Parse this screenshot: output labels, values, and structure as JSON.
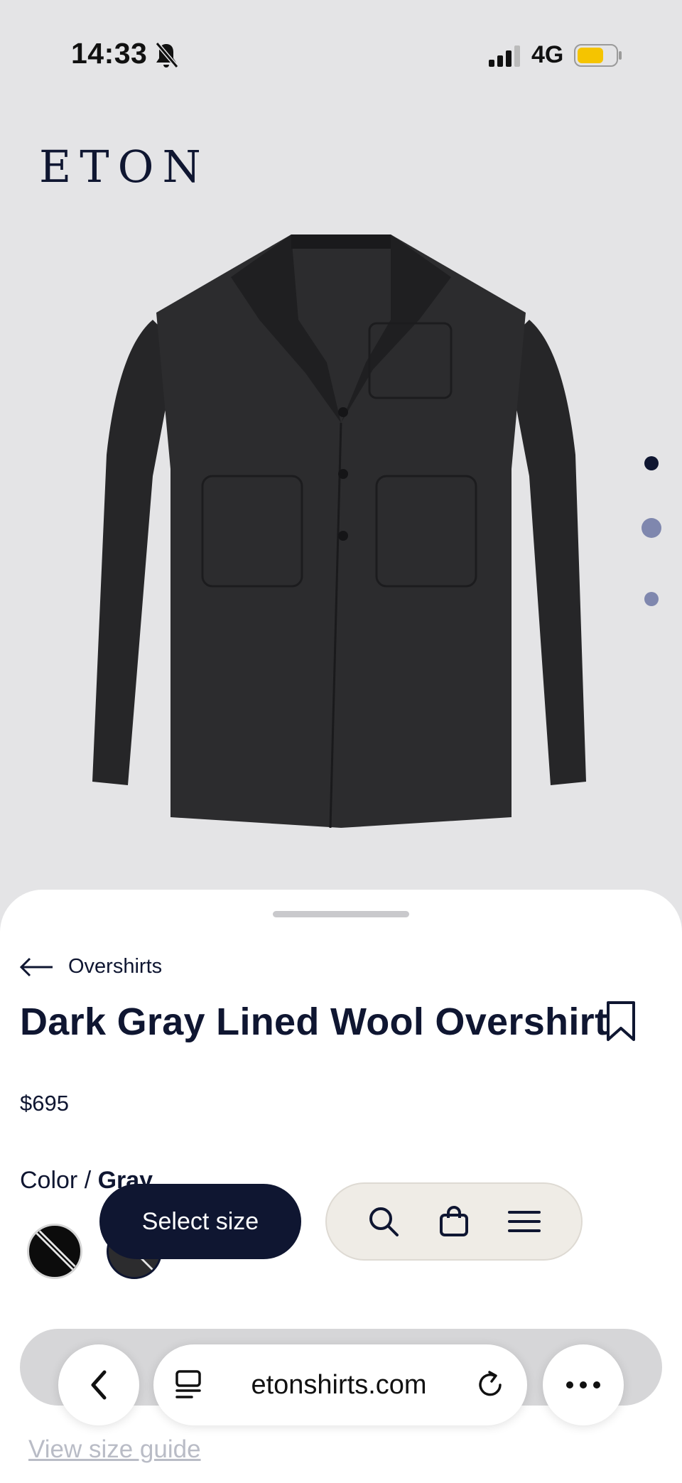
{
  "status_bar": {
    "time": "14:33",
    "network": "4G",
    "battery_color": "#f5c400"
  },
  "brand": {
    "logo_text": "ETON"
  },
  "product": {
    "breadcrumb_label": "Overshirts",
    "title": "Dark Gray Lined Wool Overshirt",
    "price": "$695",
    "color_label": "Color / ",
    "color_value": "Gray",
    "image_dots": 3,
    "active_dot": 1
  },
  "actions": {
    "select_size_label": "Select size",
    "size_guide_label": "View size guide"
  },
  "browser": {
    "url": "etonshirts.com"
  },
  "colors": {
    "navy": "#0f1631",
    "background": "#e4e4e6",
    "pill_bg": "#efece6"
  }
}
